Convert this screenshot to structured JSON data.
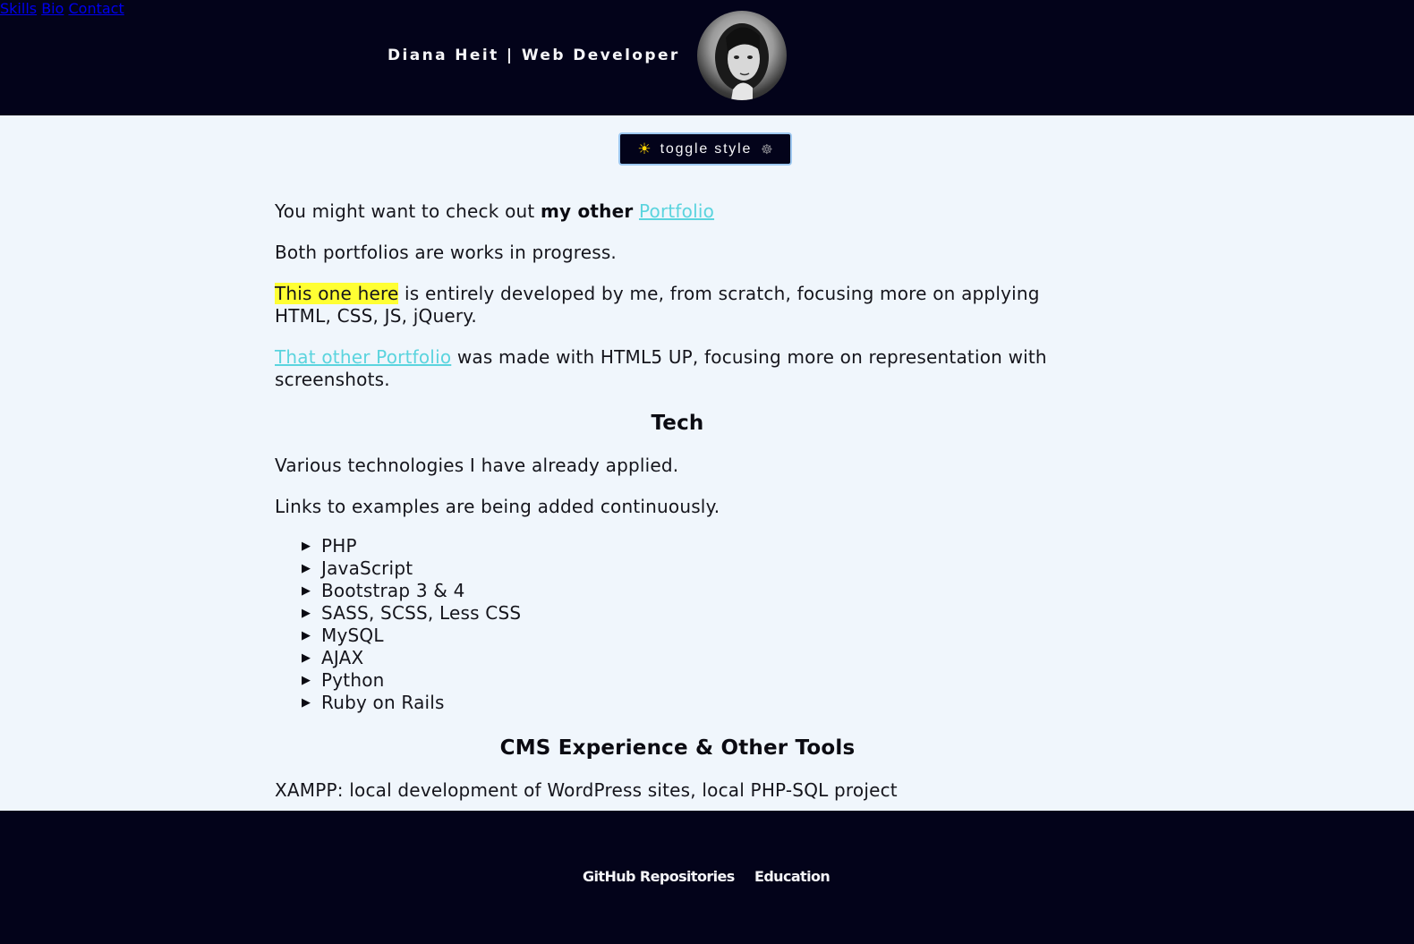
{
  "header": {
    "brand": "Diana Heit | Web Developer",
    "nav": {
      "skills": "Skills",
      "bio": "Bio",
      "contact": "Contact"
    }
  },
  "toggle": {
    "sun": "☀",
    "label": "toggle style",
    "moon": "☸"
  },
  "intro": {
    "p1_prefix": "You might want to check out ",
    "p1_strong": "my other",
    "p1_link": "Portfolio",
    "p2": "Both portfolios are works in progress.",
    "p3_highlight": "This one here",
    "p3_rest": " is entirely developed by me, from scratch, focusing more on applying HTML, CSS, JS, jQuery.",
    "p4_link": "That other Portfolio",
    "p4_rest": " was made with HTML5 UP, focusing more on representation with screenshots."
  },
  "tech": {
    "heading": "Tech",
    "p1": "Various technologies I have already applied.",
    "p2": "Links to examples are being added continuously.",
    "items": [
      "PHP",
      "JavaScript",
      "Bootstrap 3 & 4",
      "SASS, SCSS, Less CSS",
      "MySQL",
      "AJAX",
      "Python",
      "Ruby on Rails"
    ]
  },
  "cms": {
    "heading": "CMS Experience & Other Tools",
    "p1": "XAMPP: local development of WordPress sites, local PHP-SQL project"
  },
  "footer": {
    "github": "GitHub Repositories",
    "education": "Education"
  },
  "colors": {
    "header_bg": "#03031a",
    "page_bg": "#f0f6fc",
    "link": "#5bd4de",
    "highlight": "#ffff33"
  }
}
